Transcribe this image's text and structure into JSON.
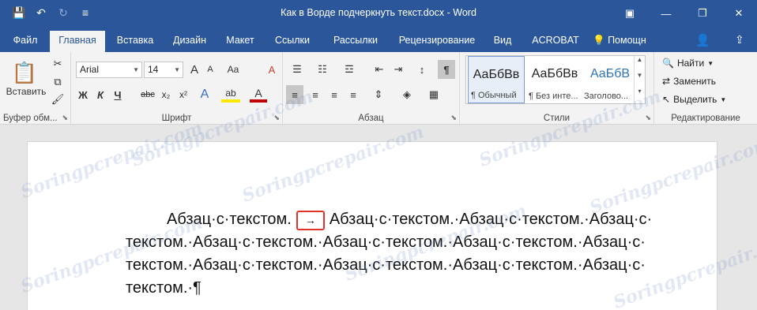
{
  "titlebar": {
    "title": "Как в Ворде подчеркнуть текст.docx - Word",
    "save_icon": "💾",
    "undo_icon": "↶",
    "redo_icon": "↻",
    "customize_icon": "≡",
    "ribbon_options_icon": "▣",
    "minimize_icon": "—",
    "restore_icon": "❐",
    "close_icon": "✕"
  },
  "tabs": [
    {
      "label": "Файл"
    },
    {
      "label": "Главная"
    },
    {
      "label": "Вставка"
    },
    {
      "label": "Дизайн"
    },
    {
      "label": "Макет"
    },
    {
      "label": "Ссылки"
    },
    {
      "label": "Рассылки"
    },
    {
      "label": "Рецензирование"
    },
    {
      "label": "Вид"
    },
    {
      "label": "ACROBAT"
    }
  ],
  "help": {
    "label": "Помощн",
    "icon": "💡"
  },
  "user_icon": "👤",
  "share_icon": "⇪",
  "ribbon": {
    "clipboard": {
      "label": "Буфер обм...",
      "paste_label": "Вставить",
      "paste_icon": "📋",
      "cut_icon": "✂",
      "copy_icon": "⧉",
      "format_painter_icon": "🖌"
    },
    "font": {
      "label": "Шрифт",
      "font_name": "Arial",
      "font_size": "14",
      "bold": "Ж",
      "italic": "К",
      "underline": "Ч",
      "strike": "abc",
      "subscript": "x₂",
      "superscript": "x²",
      "grow": "A",
      "shrink": "A",
      "case": "Aa",
      "clear": "A",
      "effects": "A",
      "highlight": "ab",
      "color": "A"
    },
    "paragraph": {
      "label": "Абзац",
      "bullets_icon": "☰",
      "numbering_icon": "☷",
      "multilevel_icon": "☲",
      "decrease_indent_icon": "⇤",
      "increase_indent_icon": "⇥",
      "sort_icon": "↕",
      "pilcrow": "¶",
      "align_left_icon": "≡",
      "align_center_icon": "≡",
      "align_right_icon": "≡",
      "justify_icon": "≡",
      "line_spacing_icon": "⇕",
      "shading_icon": "◈",
      "borders_icon": "▦"
    },
    "styles": {
      "label": "Стили",
      "items": [
        {
          "sample": "АаБбВв",
          "name": "¶ Обычный"
        },
        {
          "sample": "АаБбВв",
          "name": "¶ Без инте..."
        },
        {
          "sample": "АаБбВ",
          "name": "Заголово..."
        }
      ]
    },
    "editing": {
      "label": "Редактирование",
      "find": "Найти",
      "replace": "Заменить",
      "select": "Выделить"
    }
  },
  "document": {
    "first_line_text": "Абзац·с·текстом.",
    "tab_mark": "→",
    "rest_line1": "Абзац·с·текстом.·Абзац·с·текстом.·Абзац·с·",
    "line2": "текстом.·Абзац·с·текстом.·Абзац·с·текстом.·Абзац·с·текстом.·Абзац·с·",
    "line3": "текстом.·Абзац·с·текстом.·Абзац·с·текстом.·Абзац·с·текстом.·Абзац·с·",
    "line4": "текстом.·¶"
  },
  "watermark": "Soringpcrepair.com",
  "colors": {
    "accent": "#2b579a",
    "tab_highlight": "#e0342a"
  }
}
